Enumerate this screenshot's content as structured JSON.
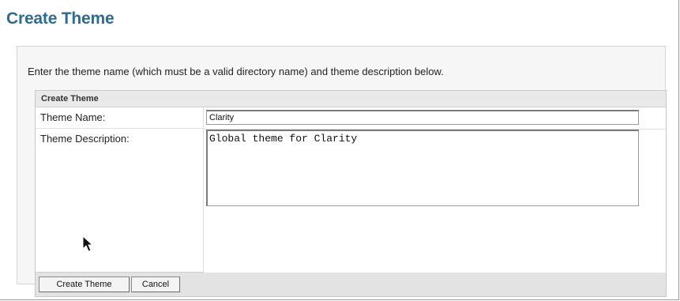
{
  "page": {
    "title": "Create Theme",
    "instructions": "Enter the theme name (which must be a valid directory name) and theme description below."
  },
  "form": {
    "header": "Create Theme",
    "name_label": "Theme Name:",
    "name_value": "Clarity",
    "description_label": "Theme Description:",
    "description_value": "Global theme for Clarity"
  },
  "buttons": {
    "create": "Create Theme",
    "cancel": "Cancel"
  },
  "icons": {
    "cursor": "mouse-pointer-icon"
  },
  "colors": {
    "title": "#2d6c93",
    "panel_background": "#f6f6f6",
    "form_header_background": "#e9e9e9"
  }
}
